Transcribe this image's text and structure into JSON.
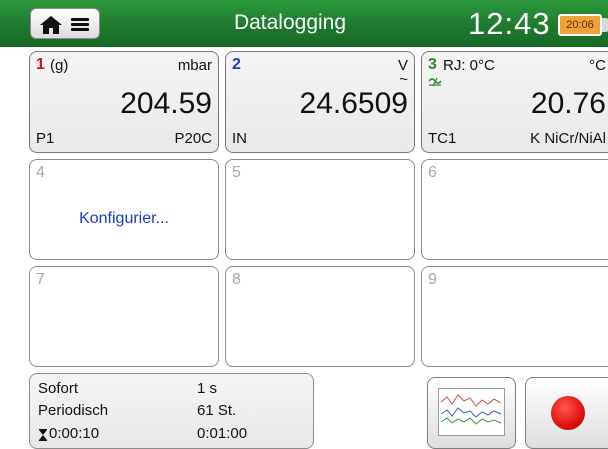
{
  "header": {
    "title": "Datalogging",
    "time": "12:43",
    "battery_time": "20:06"
  },
  "channels": [
    {
      "number": "1",
      "mode": "(g)",
      "unit": "mbar",
      "value": "204.59",
      "port": "P1",
      "module": "P20C"
    },
    {
      "number": "2",
      "unit": "V",
      "ac_symbol": "~",
      "value": "24.6509",
      "port": "IN"
    },
    {
      "number": "3",
      "rj": "RJ: 0°C",
      "unit": "°C",
      "value": "20.76",
      "port": "TC1",
      "sensor": "K  NiCr/NiAl"
    },
    {
      "number": "4",
      "action": "Konfigurier..."
    },
    {
      "number": "5"
    },
    {
      "number": "6"
    },
    {
      "number": "7"
    },
    {
      "number": "8"
    },
    {
      "number": "9"
    }
  ],
  "settings": {
    "trigger_label": "Sofort",
    "interval_value": "1 s",
    "mode_label": "Periodisch",
    "count_value": "61 St.",
    "elapsed_value": "0:00:10",
    "total_value": "0:01:00"
  },
  "icons": {
    "home": "home-icon",
    "menu": "menu-icon",
    "hourglass": "hourglass-icon",
    "graph": "graph-icon",
    "record": "record-icon"
  },
  "colors": {
    "header": "#1e7a2d",
    "channel1": "#d01010",
    "channel2": "#1a3cc8",
    "channel3": "#2a8a2a",
    "record": "#e01010"
  }
}
